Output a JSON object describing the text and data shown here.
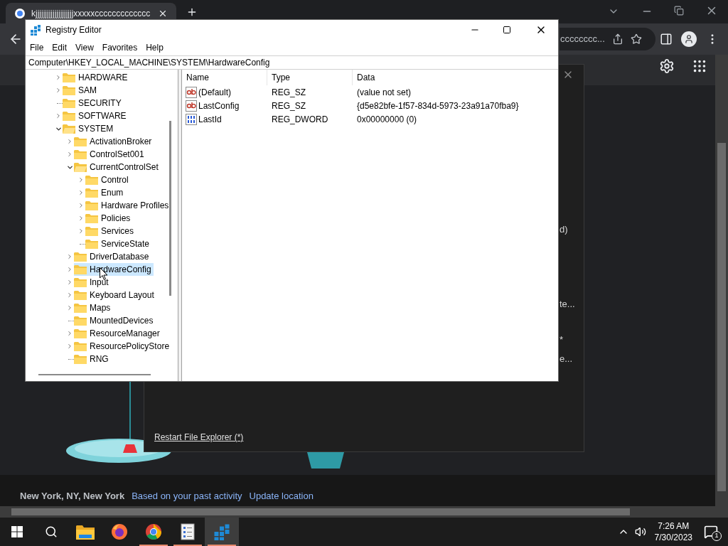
{
  "browser": {
    "tab_title": "kjjjjjjjjjjjjjjjjjjjjxxxxxccccccccccccc",
    "address_fragment": "cccccccc..."
  },
  "dialog": {
    "fragments": [
      "d)",
      "te...",
      "*",
      "e..."
    ],
    "link": "Restart File Explorer (*)"
  },
  "footer": {
    "location": "New York, NY, New York",
    "activity_link": "Based on your past activity",
    "update_link": "Update location"
  },
  "registry": {
    "title": "Registry Editor",
    "menu": [
      "File",
      "Edit",
      "View",
      "Favorites",
      "Help"
    ],
    "address": "Computer\\HKEY_LOCAL_MACHINE\\SYSTEM\\HardwareConfig",
    "tree": [
      {
        "label": "HARDWARE",
        "expandable": true,
        "expanded": false,
        "selected": false
      },
      {
        "label": "SAM",
        "expandable": true,
        "expanded": false,
        "selected": false
      },
      {
        "label": "SECURITY",
        "expandable": false,
        "selected": false
      },
      {
        "label": "SOFTWARE",
        "expandable": true,
        "expanded": false,
        "selected": false
      },
      {
        "label": "SYSTEM",
        "expandable": true,
        "expanded": true,
        "selected": false,
        "children": [
          {
            "label": "ActivationBroker",
            "expandable": true,
            "expanded": false,
            "selected": false
          },
          {
            "label": "ControlSet001",
            "expandable": true,
            "expanded": false,
            "selected": false
          },
          {
            "label": "CurrentControlSet",
            "expandable": true,
            "expanded": true,
            "selected": false,
            "children": [
              {
                "label": "Control",
                "expandable": true,
                "expanded": false,
                "selected": false
              },
              {
                "label": "Enum",
                "expandable": true,
                "expanded": false,
                "selected": false
              },
              {
                "label": "Hardware Profiles",
                "expandable": true,
                "expanded": false,
                "selected": false
              },
              {
                "label": "Policies",
                "expandable": true,
                "expanded": false,
                "selected": false
              },
              {
                "label": "Services",
                "expandable": true,
                "expanded": false,
                "selected": false
              },
              {
                "label": "ServiceState",
                "expandable": false,
                "selected": false
              }
            ]
          },
          {
            "label": "DriverDatabase",
            "expandable": true,
            "expanded": false,
            "selected": false
          },
          {
            "label": "HardwareConfig",
            "expandable": true,
            "expanded": false,
            "selected": true
          },
          {
            "label": "Input",
            "expandable": true,
            "expanded": false,
            "selected": false
          },
          {
            "label": "Keyboard Layout",
            "expandable": true,
            "expanded": false,
            "selected": false
          },
          {
            "label": "Maps",
            "expandable": true,
            "expanded": false,
            "selected": false
          },
          {
            "label": "MountedDevices",
            "expandable": false,
            "selected": false
          },
          {
            "label": "ResourceManager",
            "expandable": true,
            "expanded": false,
            "selected": false
          },
          {
            "label": "ResourcePolicyStore",
            "expandable": true,
            "expanded": false,
            "selected": false
          },
          {
            "label": "RNG",
            "expandable": false,
            "selected": false
          }
        ]
      }
    ],
    "columns": [
      "Name",
      "Type",
      "Data"
    ],
    "values": [
      {
        "kind": "string",
        "name": "(Default)",
        "type": "REG_SZ",
        "data": "(value not set)"
      },
      {
        "kind": "string",
        "name": "LastConfig",
        "type": "REG_SZ",
        "data": "{d5e82bfe-1f57-834d-5973-23a91a70fba9}"
      },
      {
        "kind": "binary",
        "name": "LastId",
        "type": "REG_DWORD",
        "data": "0x00000000 (0)"
      }
    ]
  },
  "taskbar": {
    "apps": [
      {
        "kind": "explorer",
        "running": false,
        "active": false
      },
      {
        "kind": "firefox",
        "running": false,
        "active": false
      },
      {
        "kind": "chrome",
        "running": true,
        "active": false
      },
      {
        "kind": "notepad",
        "running": true,
        "active": false
      },
      {
        "kind": "regedit",
        "running": true,
        "active": true
      }
    ],
    "time": "7:26 AM",
    "date": "7/30/2023",
    "notifications": "1"
  }
}
